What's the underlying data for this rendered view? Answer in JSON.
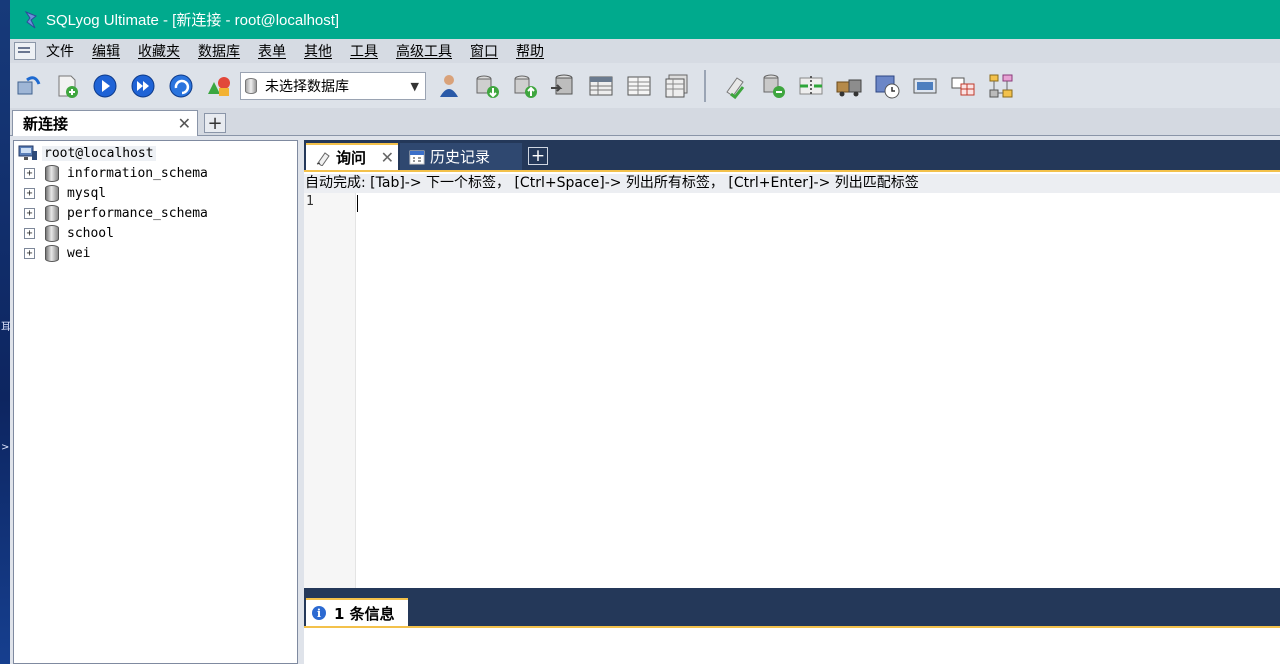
{
  "window": {
    "title": "SQLyog Ultimate - [新连接 - root@localhost]"
  },
  "desktop": {
    "marks": [
      "耳",
      ">"
    ]
  },
  "menubar": {
    "items": [
      {
        "label": "文件",
        "name": "menu-file"
      },
      {
        "label": "编辑",
        "name": "menu-edit"
      },
      {
        "label": "收藏夹",
        "name": "menu-favorites"
      },
      {
        "label": "数据库",
        "name": "menu-database"
      },
      {
        "label": "表单",
        "name": "menu-table"
      },
      {
        "label": "其他",
        "name": "menu-others"
      },
      {
        "label": "工具",
        "name": "menu-tools"
      },
      {
        "label": "高级工具",
        "name": "menu-advanced-tools"
      },
      {
        "label": "窗口",
        "name": "menu-window"
      },
      {
        "label": "帮助",
        "name": "menu-help"
      }
    ]
  },
  "toolbar": {
    "database_selector": {
      "value": "未选择数据库"
    },
    "buttons_left": [
      "new-connection-icon",
      "new-query-icon",
      "execute-query-icon",
      "execute-all-icon",
      "refresh-icon",
      "schema-designer-icon"
    ],
    "buttons_right": [
      "user-manager-icon",
      "backup-db-icon",
      "restore-db-icon",
      "import-icon",
      "table-data-icon",
      "table-structure-icon",
      "table-indexes-icon"
    ],
    "buttons_far": [
      "sql-formatter-icon",
      "sync-db-icon",
      "schema-sync-icon",
      "data-migrate-icon",
      "scheduler-icon",
      "monitor-icon",
      "query-builder-icon",
      "schema-diagram-icon"
    ]
  },
  "connection_tab": {
    "label": "新连接",
    "close": "✕",
    "add": "+"
  },
  "object_browser": {
    "root": "root@localhost",
    "databases": [
      "information_schema",
      "mysql",
      "performance_schema",
      "school",
      "wei"
    ]
  },
  "query_tabs": {
    "active": {
      "label": "询问",
      "close": "✕"
    },
    "history": {
      "label": "历史记录"
    },
    "add": "+"
  },
  "editor": {
    "hint": "自动完成: [Tab]-> 下一个标签， [Ctrl+Space]-> 列出所有标签， [Ctrl+Enter]-> 列出匹配标签",
    "line_number": "1"
  },
  "messages": {
    "info_icon": "i",
    "tab_label": "1 条信息"
  },
  "colors": {
    "titlebar": "#00aa8d",
    "panel_dark": "#243859",
    "tab_accent": "#f3c14b"
  }
}
